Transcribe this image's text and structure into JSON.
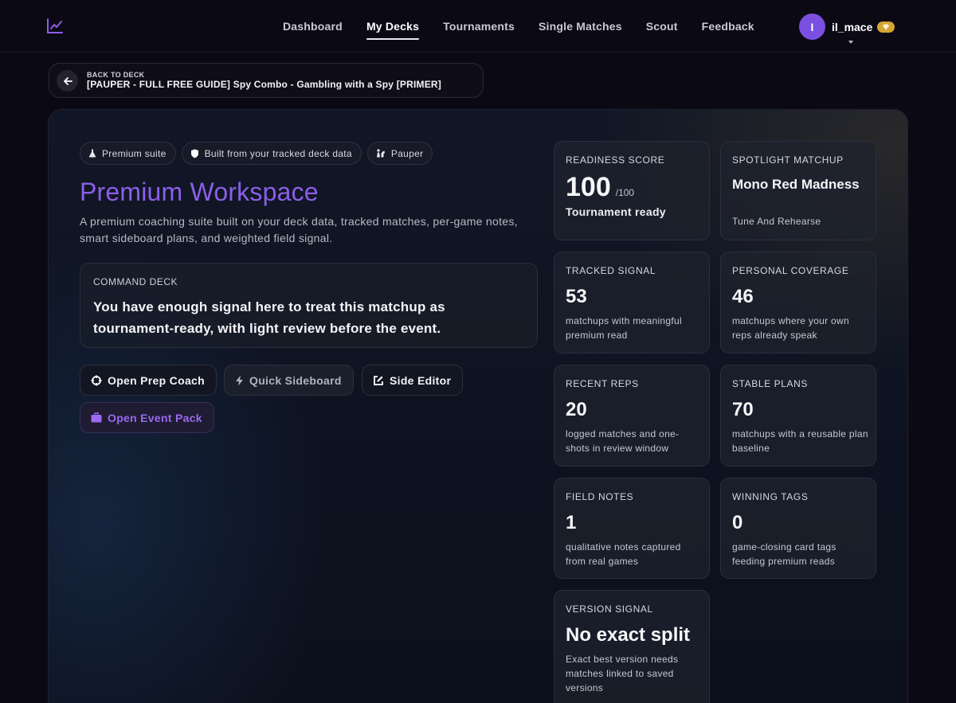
{
  "nav": {
    "links": [
      "Dashboard",
      "My Decks",
      "Tournaments",
      "Single Matches",
      "Scout",
      "Feedback"
    ],
    "active": "My Decks",
    "user": {
      "initial": "I",
      "name": "il_mace"
    }
  },
  "back": {
    "small": "BACK TO DECK",
    "title": "[PAUPER - FULL FREE GUIDE] Spy Combo - Gambling with a Spy [PRIMER]"
  },
  "chips": [
    "Premium suite",
    "Built from your tracked deck data",
    "Pauper"
  ],
  "workspace": {
    "title": "Premium Workspace",
    "description": "A premium coaching suite built on your deck data, tracked matches, per-game notes, smart sideboard plans, and weighted field signal."
  },
  "command": {
    "label": "COMMAND DECK",
    "text": "You have enough signal here to treat this matchup as tournament-ready, with light review before the event."
  },
  "buttons": {
    "prep": "Open Prep Coach",
    "sideboard": "Quick Sideboard",
    "editor": "Side Editor",
    "event": "Open Event Pack"
  },
  "stats": {
    "readiness": {
      "label": "READINESS SCORE",
      "value": "100",
      "suffix": "/100",
      "desc": "Tournament ready"
    },
    "spotlight": {
      "label": "SPOTLIGHT MATCHUP",
      "value": "Mono Red Madness",
      "desc": "Tune And Rehearse"
    },
    "tracked": {
      "label": "TRACKED SIGNAL",
      "value": "53",
      "desc": "matchups with meaningful premium read"
    },
    "coverage": {
      "label": "PERSONAL COVERAGE",
      "value": "46",
      "desc": "matchups where your own reps already speak"
    },
    "recent": {
      "label": "RECENT REPS",
      "value": "20",
      "desc": "logged matches and one-shots in review window"
    },
    "stable": {
      "label": "STABLE PLANS",
      "value": "70",
      "desc": "matchups with a reusable plan baseline"
    },
    "notes": {
      "label": "FIELD NOTES",
      "value": "1",
      "desc": "qualitative notes captured from real games"
    },
    "tags": {
      "label": "WINNING TAGS",
      "value": "0",
      "desc": "game-closing card tags feeding premium reads"
    },
    "version": {
      "label": "VERSION SIGNAL",
      "value": "No exact split",
      "desc": "Exact best version needs matches linked to saved versions"
    }
  },
  "colors": {
    "accent": "#8c5ee8",
    "gem": "#d6a635",
    "background": "#0b0a14"
  },
  "icons": [
    "chart-line-icon",
    "arrow-left-icon",
    "flask-icon",
    "shield-icon",
    "chess-icon",
    "crosshair-icon",
    "bolt-icon",
    "edit-icon",
    "briefcase-icon",
    "gem-icon",
    "chevron-down-icon"
  ]
}
